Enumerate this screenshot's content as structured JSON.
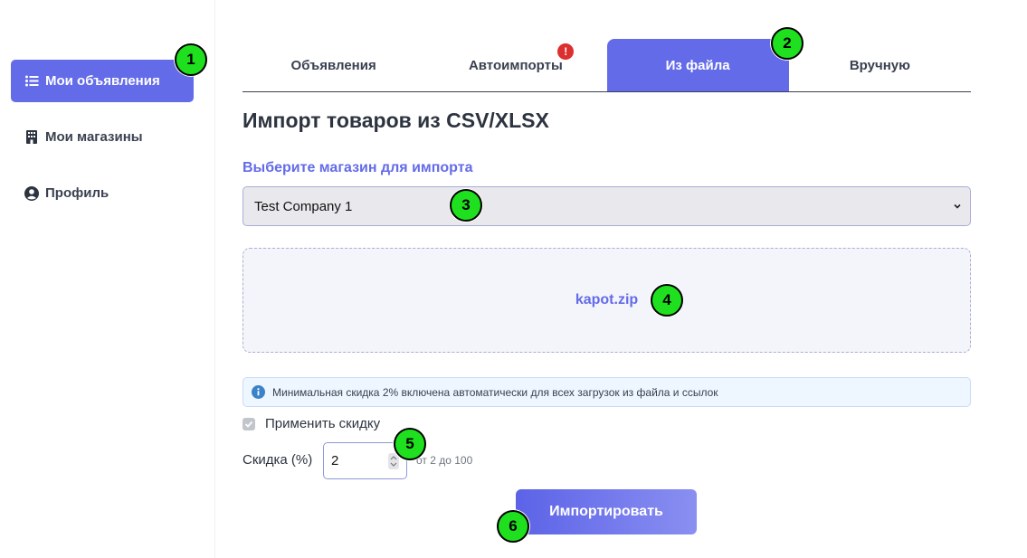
{
  "sidebar": {
    "items": [
      {
        "label": "Мои объявления",
        "icon": "list-icon"
      },
      {
        "label": "Мои магазины",
        "icon": "building-icon"
      },
      {
        "label": "Профиль",
        "icon": "user-circle-icon"
      }
    ]
  },
  "tabs": [
    {
      "label": "Объявления"
    },
    {
      "label": "Автоимпорты",
      "alert": "!"
    },
    {
      "label": "Из файла"
    },
    {
      "label": "Вручную"
    }
  ],
  "page_title": "Импорт товаров из CSV/XLSX",
  "store_section": {
    "label": "Выберите магазин для импорта",
    "selected": "Test Company 1"
  },
  "dropzone": {
    "file_name": "kapot.zip"
  },
  "info_note": "Минимальная скидка 2% включена автоматически для всех загрузок из файла и ссылок",
  "apply_discount": {
    "label": "Применить скидку",
    "checked": true
  },
  "discount": {
    "label": "Скидка (%)",
    "value": "2",
    "range_hint": "от 2 до 100"
  },
  "import_button": "Импортировать",
  "annotations": [
    "1",
    "2",
    "3",
    "4",
    "5",
    "6"
  ],
  "colors": {
    "accent": "#636be9",
    "annotation": "#1fe01f",
    "alert": "#dc2f2f"
  }
}
